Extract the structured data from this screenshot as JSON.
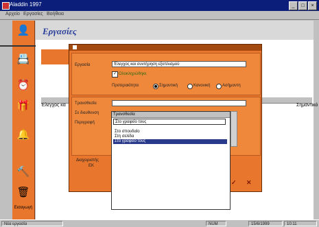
{
  "window": {
    "title": "Aladdin 1997"
  },
  "menu": [
    "Αρχείο",
    "Εργασίες",
    "Βοήθεια"
  ],
  "sidebar": {
    "bottom_label": "Εισαγωγή"
  },
  "main": {
    "title": "Εργασίες",
    "list_item": "Έλεγχος κα",
    "list_item_right": "Σημαντικό"
  },
  "dialog": {
    "task_label": "Εργασία",
    "task_value": "Έλεγχος και συντήρηση εξοπλισμού",
    "done_label": "Ολοκληρώθηκε",
    "priority_label": "Προτεραιότητα",
    "priority_options": [
      "Σημαντική",
      "Κανονική",
      "Ασήμαντη"
    ],
    "deadline_label": "Τρανσθεσία",
    "recipient_label": "Σε διευθυνση",
    "description_label": "Περιγραφή",
    "bottom_label": "Διαχειριστής",
    "bottom_sub": "ΕΚ",
    "ok_glyph": "✓",
    "cancel_glyph": "✕"
  },
  "popup": {
    "header": "Τρανσθεσία",
    "selected": "Στο γραφείο τους",
    "items": [
      "Στο σπουδαίο",
      "Στη σελίδα",
      "Στο γραφείο τους"
    ]
  },
  "status": {
    "left": "Νέα εργασία",
    "num": "NUM",
    "date": "15/6/1999",
    "time": "10:11"
  }
}
